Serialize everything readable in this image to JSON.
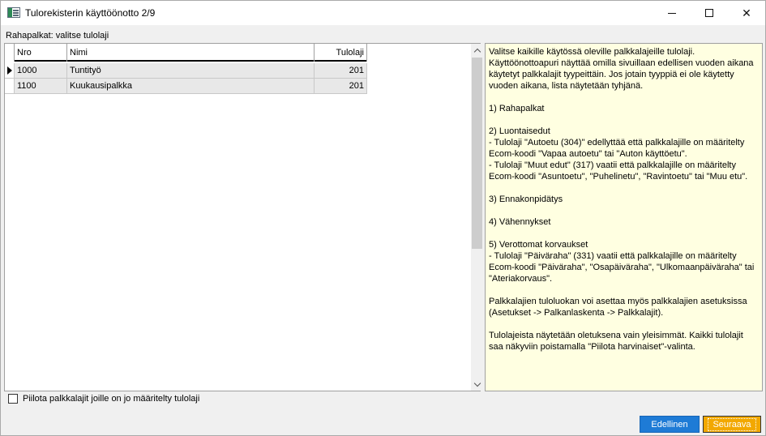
{
  "window": {
    "title": "Tulorekisterin käyttöönotto 2/9",
    "minimize_glyph": "",
    "maximize_glyph": "",
    "close_glyph": "✕"
  },
  "section": {
    "label": "Rahapalkat: valitse tulolaji"
  },
  "grid": {
    "columns": [
      "Nro",
      "Nimi",
      "Tulolaji"
    ],
    "rows": [
      {
        "nro": "1000",
        "nimi": "Tuntityö",
        "tulolaji": "201"
      },
      {
        "nro": "1100",
        "nimi": "Kuukausipalkka",
        "tulolaji": "201"
      }
    ]
  },
  "help": {
    "paragraphs": [
      "Valitse kaikille käytössä oleville palkkalajeille tulolaji. Käyttöönottoapuri näyttää omilla sivuillaan edellisen vuoden aikana käytetyt palkkalajit tyypeittäin. Jos jotain tyyppiä ei ole käytetty vuoden aikana, lista näytetään tyhjänä.",
      "1) Rahapalkat",
      "2) Luontaisedut\n- Tulolaji \"Autoetu (304)\" edellyttää että palkkalajille on määritelty Ecom-koodi \"Vapaa autoetu\" tai \"Auton käyttöetu\".\n- Tulolaji \"Muut edut\" (317) vaatii että palkkalajille on määritelty Ecom-koodi \"Asuntoetu\", \"Puhelinetu\", \"Ravintoetu\" tai \"Muu etu\".",
      "3) Ennakonpidätys",
      "4) Vähennykset",
      "5) Verottomat korvaukset\n- Tulolaji \"Päiväraha\" (331) vaatii että palkkalajille on määritelty Ecom-koodi \"Päiväraha\", \"Osapäiväraha\", \"Ulkomaanpäiväraha\" tai \"Ateriakorvaus\".",
      "Palkkalajien tuloluokan voi asettaa myös palkkalajien asetuksissa (Asetukset -> Palkanlaskenta -> Palkkalajit).",
      "Tulolajeista näytetään oletuksena vain yleisimmät. Kaikki tulolajit saa näkyviin poistamalla \"Piilota harvinaiset\"-valinta."
    ]
  },
  "filter": {
    "checkbox_label": "Piilota palkkalajit joille on jo määritelty tulolaji",
    "checked": false
  },
  "buttons": {
    "prev_label": "Edellinen",
    "next_label": "Seuraava"
  },
  "colors": {
    "help_background": "#ffffe1",
    "prev_button": "#1e7bd6",
    "next_button": "#f2a800"
  }
}
